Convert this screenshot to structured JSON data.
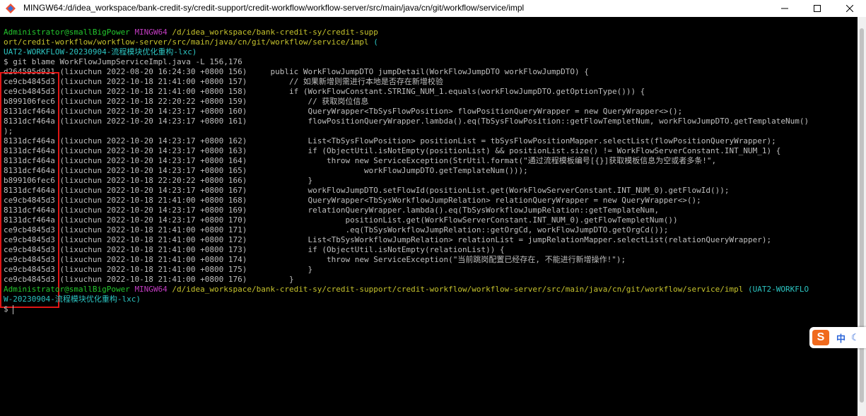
{
  "window": {
    "title": "MINGW64:/d/idea_workspace/bank-credit-sy/credit-support/credit-workflow/workflow-server/src/main/java/cn/git/workflow/service/impl",
    "minimize_icon": "minimize-icon",
    "maximize_icon": "maximize-icon",
    "close_icon": "close-icon"
  },
  "terminal": {
    "prompt1": {
      "user": "Administrator@smallBigPower",
      "env": "MINGW64",
      "path_line1": "/d/idea_workspace/bank-credit-sy/credit-supp",
      "path_line2": "ort/credit-workflow/workflow-server/src/main/java/cn/git/workflow/service/impl",
      "branch_open": "(",
      "branch_line3": "UAT2-WORKFLOW-20230904-流程模块优化重构-lxc)"
    },
    "command": "$ git blame WorkFlowJumpServiceImpl.java -L 156,176",
    "blame_lines": [
      {
        "hash": "d264595d931",
        "meta": " (lixuchun 2022-08-20 16:24:30 +0800 156)",
        "code": "     public WorkFlowJumpDTO jumpDetail(WorkFlowJumpDTO workFlowJumpDTO) {"
      },
      {
        "hash": "ce9cb4845d3",
        "meta": " (lixuchun 2022-10-18 21:41:00 +0800 157)",
        "code": "         // 如果新增则需进行本地是否存在新增校验"
      },
      {
        "hash": "ce9cb4845d3",
        "meta": " (lixuchun 2022-10-18 21:41:00 +0800 158)",
        "code": "         if (WorkFlowConstant.STRING_NUM_1.equals(workFlowJumpDTO.getOptionType())) {"
      },
      {
        "hash": "b899106fec6",
        "meta": " (lixuchun 2022-10-18 22:20:22 +0800 159)",
        "code": "             // 获取岗位信息"
      },
      {
        "hash": "8131dcf464a",
        "meta": " (lixuchun 2022-10-20 14:23:17 +0800 160)",
        "code": "             QueryWrapper<TbSysFlowPosition> flowPositionQueryWrapper = new QueryWrapper<>();"
      },
      {
        "hash": "8131dcf464a",
        "meta": " (lixuchun 2022-10-20 14:23:17 +0800 161)",
        "code": "             flowPositionQueryWrapper.lambda().eq(TbSysFlowPosition::getFlowTempletNum, workFlowJumpDTO.getTemplateNum()"
      },
      {
        "hash": ");",
        "meta": "",
        "code": ""
      },
      {
        "hash": "8131dcf464a",
        "meta": " (lixuchun 2022-10-20 14:23:17 +0800 162)",
        "code": "             List<TbSysFlowPosition> positionList = tbSysFlowPositionMapper.selectList(flowPositionQueryWrapper);"
      },
      {
        "hash": "8131dcf464a",
        "meta": " (lixuchun 2022-10-20 14:23:17 +0800 163)",
        "code": "             if (ObjectUtil.isNotEmpty(positionList) && positionList.size() != WorkFlowServerConstant.INT_NUM_1) {"
      },
      {
        "hash": "8131dcf464a",
        "meta": " (lixuchun 2022-10-20 14:23:17 +0800 164)",
        "code": "                 throw new ServiceException(StrUtil.format(\"通过流程模板编号[{}]获取模板信息为空或者多条!\","
      },
      {
        "hash": "8131dcf464a",
        "meta": " (lixuchun 2022-10-20 14:23:17 +0800 165)",
        "code": "                         workFlowJumpDTO.getTemplateNum()));"
      },
      {
        "hash": "b899106fec6",
        "meta": " (lixuchun 2022-10-18 22:20:22 +0800 166)",
        "code": "             }"
      },
      {
        "hash": "8131dcf464a",
        "meta": " (lixuchun 2022-10-20 14:23:17 +0800 167)",
        "code": "             workFlowJumpDTO.setFlowId(positionList.get(WorkFlowServerConstant.INT_NUM_0).getFlowId());"
      },
      {
        "hash": "ce9cb4845d3",
        "meta": " (lixuchun 2022-10-18 21:41:00 +0800 168)",
        "code": "             QueryWrapper<TbSysWorkflowJumpRelation> relationQueryWrapper = new QueryWrapper<>();"
      },
      {
        "hash": "8131dcf464a",
        "meta": " (lixuchun 2022-10-20 14:23:17 +0800 169)",
        "code": "             relationQueryWrapper.lambda().eq(TbSysWorkflowJumpRelation::getTemplateNum,"
      },
      {
        "hash": "8131dcf464a",
        "meta": " (lixuchun 2022-10-20 14:23:17 +0800 170)",
        "code": "                     positionList.get(WorkFlowServerConstant.INT_NUM_0).getFlowTempletNum())"
      },
      {
        "hash": "ce9cb4845d3",
        "meta": " (lixuchun 2022-10-18 21:41:00 +0800 171)",
        "code": "                     .eq(TbSysWorkflowJumpRelation::getOrgCd, workFlowJumpDTO.getOrgCd());"
      },
      {
        "hash": "ce9cb4845d3",
        "meta": " (lixuchun 2022-10-18 21:41:00 +0800 172)",
        "code": "             List<TbSysWorkflowJumpRelation> relationList = jumpRelationMapper.selectList(relationQueryWrapper);"
      },
      {
        "hash": "ce9cb4845d3",
        "meta": " (lixuchun 2022-10-18 21:41:00 +0800 173)",
        "code": "             if (ObjectUtil.isNotEmpty(relationList)) {"
      },
      {
        "hash": "ce9cb4845d3",
        "meta": " (lixuchun 2022-10-18 21:41:00 +0800 174)",
        "code": "                 throw new ServiceException(\"当前跳岗配置已经存在, 不能进行新增操作!\");"
      },
      {
        "hash": "ce9cb4845d3",
        "meta": " (lixuchun 2022-10-18 21:41:00 +0800 175)",
        "code": "             }"
      },
      {
        "hash": "ce9cb4845d3",
        "meta": " (lixuchun 2022-10-18 21:41:00 +0800 176)",
        "code": "         }"
      }
    ],
    "prompt2": {
      "user": "Administrator@smallBigPower",
      "env": "MINGW64",
      "path": "/d/idea_workspace/bank-credit-sy/credit-support/credit-workflow/workflow-server/src/main/java/cn/git/workflow/service/impl",
      "branch_part1": "(UAT2-WORKFLO",
      "branch_part2": "W-20230904-流程模块优化重构-lxc)"
    },
    "input_prompt": "$"
  },
  "ime": {
    "logo": "S",
    "lang": "中",
    "mode_icon": "moon-icon"
  }
}
